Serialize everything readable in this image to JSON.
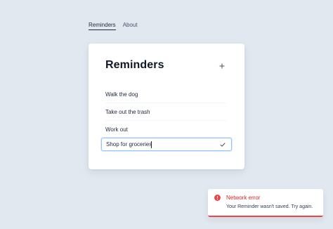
{
  "nav": {
    "items": [
      {
        "label": "Reminders",
        "active": true
      },
      {
        "label": "About",
        "active": false
      }
    ]
  },
  "card": {
    "title": "Reminders",
    "add_icon": "plus-icon",
    "items": [
      {
        "label": "Walk the dog"
      },
      {
        "label": "Take out the trash"
      },
      {
        "label": "Work out"
      }
    ],
    "editing": {
      "value": "Shop for groceries",
      "confirm_icon": "check-icon"
    }
  },
  "toast": {
    "icon": "error-circle-icon",
    "title": "Network error",
    "message": "Your Reminder wasn't saved. Try again.",
    "accent_color": "#ef4444"
  }
}
